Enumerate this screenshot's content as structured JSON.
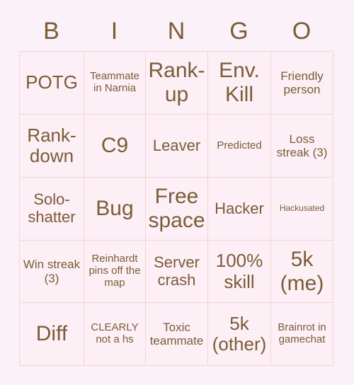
{
  "card": {
    "header_letters": [
      "B",
      "I",
      "N",
      "G",
      "O"
    ],
    "colors": {
      "page_background": "#faf2f8",
      "cell_background": "#fcf0f6",
      "border": "#f6d2d5",
      "text": "#7a5c37"
    },
    "rows": [
      [
        {
          "label": "POTG",
          "size": "fs-lg"
        },
        {
          "label": "Teammate in Narnia",
          "size": "fs-xs"
        },
        {
          "label": "Rank-up",
          "size": "fs-xl"
        },
        {
          "label": "Env. Kill",
          "size": "fs-xl"
        },
        {
          "label": "Friendly person",
          "size": "fs-sm"
        }
      ],
      [
        {
          "label": "Rank-down",
          "size": "fs-lg"
        },
        {
          "label": "C9",
          "size": "fs-xl"
        },
        {
          "label": "Leaver",
          "size": "fs-md"
        },
        {
          "label": "Predicted",
          "size": "fs-xs"
        },
        {
          "label": "Loss streak (3)",
          "size": "fs-sm"
        }
      ],
      [
        {
          "label": "Solo-shatter",
          "size": "fs-md"
        },
        {
          "label": "Bug",
          "size": "fs-xl"
        },
        {
          "label": "Free space",
          "size": "fs-xl"
        },
        {
          "label": "Hacker",
          "size": "fs-md"
        },
        {
          "label": "Hackusated",
          "size": "fs-xxs"
        }
      ],
      [
        {
          "label": "Win streak (3)",
          "size": "fs-sm"
        },
        {
          "label": "Reinhardt pins off the map",
          "size": "fs-xs"
        },
        {
          "label": "Server crash",
          "size": "fs-md"
        },
        {
          "label": "100% skill",
          "size": "fs-lg"
        },
        {
          "label": "5k (me)",
          "size": "fs-xl"
        }
      ],
      [
        {
          "label": "Diff",
          "size": "fs-xl"
        },
        {
          "label": "CLEARLY not a hs",
          "size": "fs-xs"
        },
        {
          "label": "Toxic teammate",
          "size": "fs-sm"
        },
        {
          "label": "5k (other)",
          "size": "fs-lg"
        },
        {
          "label": "Brainrot in gamechat",
          "size": "fs-xs"
        }
      ]
    ]
  }
}
